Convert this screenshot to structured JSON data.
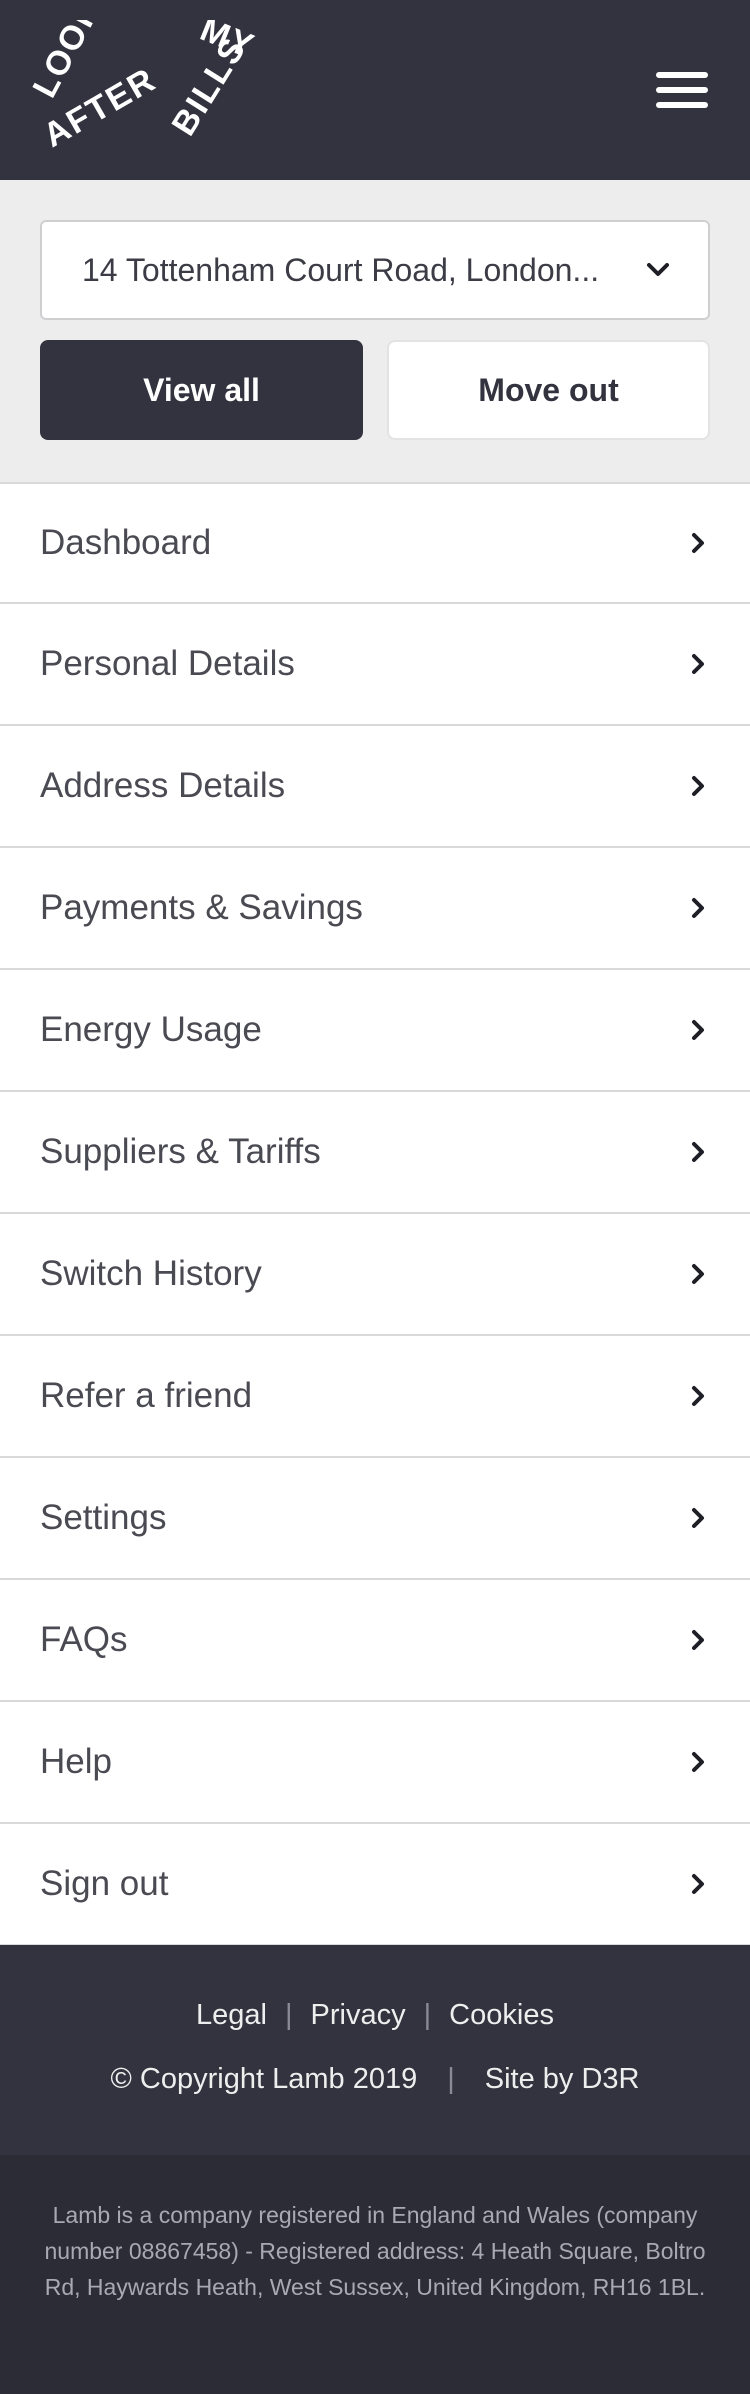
{
  "header": {
    "logo_words": [
      "LOOK",
      "MY",
      "AFTER",
      "BILLS"
    ]
  },
  "address": {
    "selected": "14 Tottenham Court Road, London..."
  },
  "buttons": {
    "view_all": "View all",
    "move_out": "Move out"
  },
  "menu": {
    "items": [
      {
        "label": "Dashboard"
      },
      {
        "label": "Personal Details"
      },
      {
        "label": "Address Details"
      },
      {
        "label": "Payments & Savings"
      },
      {
        "label": "Energy Usage"
      },
      {
        "label": "Suppliers & Tariffs"
      },
      {
        "label": "Switch History"
      },
      {
        "label": "Refer a friend"
      },
      {
        "label": "Settings"
      },
      {
        "label": "FAQs"
      },
      {
        "label": "Help"
      },
      {
        "label": "Sign out"
      }
    ]
  },
  "footer": {
    "links": [
      "Legal",
      "Privacy",
      "Cookies"
    ],
    "copyright": "© Copyright Lamb 2019",
    "site_by": "Site by D3R",
    "legal_text": "Lamb is a company registered in England and Wales (company number 08867458) - Registered address: 4 Heath Square, Boltro Rd, Haywards Heath, West Sussex, United Kingdom, RH16 1BL."
  },
  "icons": {
    "menu": "hamburger-icon",
    "dropdown": "chevron-down-icon",
    "item_arrow": "chevron-right-icon"
  },
  "colors": {
    "header_bg": "#33333f",
    "address_bg": "#ededed",
    "footer_bg": "#33333f",
    "legal_bg": "#2c2c37"
  }
}
